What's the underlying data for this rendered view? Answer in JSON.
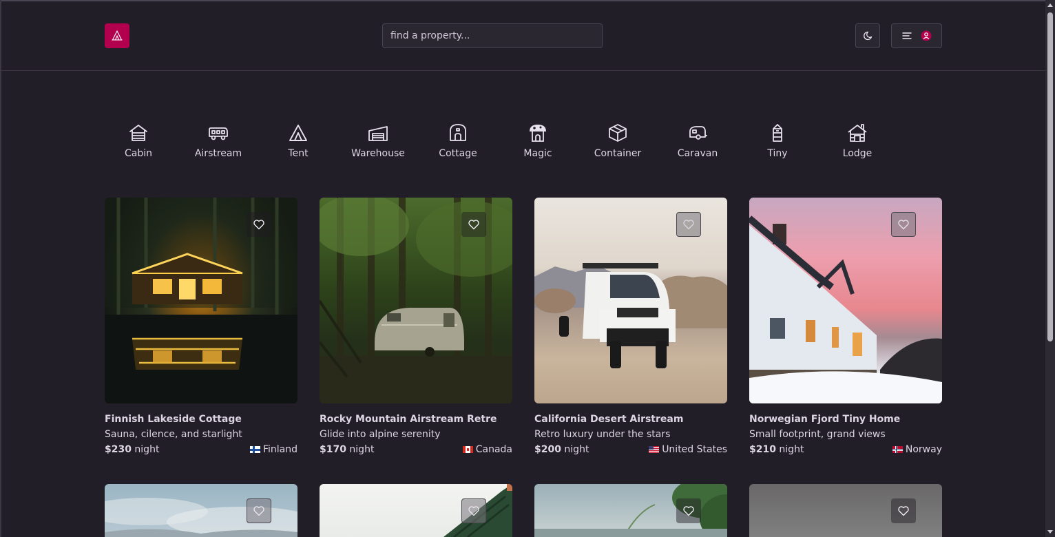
{
  "header": {
    "search_placeholder": "find a property..."
  },
  "categories": [
    {
      "label": "Cabin",
      "icon": "cabin-icon"
    },
    {
      "label": "Airstream",
      "icon": "airstream-icon"
    },
    {
      "label": "Tent",
      "icon": "tent-icon"
    },
    {
      "label": "Warehouse",
      "icon": "warehouse-icon"
    },
    {
      "label": "Cottage",
      "icon": "cottage-icon"
    },
    {
      "label": "Magic",
      "icon": "magic-icon"
    },
    {
      "label": "Container",
      "icon": "container-icon"
    },
    {
      "label": "Caravan",
      "icon": "caravan-icon"
    },
    {
      "label": "Tiny",
      "icon": "tiny-icon"
    },
    {
      "label": "Lodge",
      "icon": "lodge-icon"
    }
  ],
  "listings": [
    {
      "title": "Finnish Lakeside Cottage",
      "tagline": "Sauna, cilence, and starlight",
      "price": "$230",
      "unit": "night",
      "country": "Finland",
      "flag": "finland-flag"
    },
    {
      "title": "Rocky Mountain Airstream Retre",
      "tagline": "Glide into alpine serenity",
      "price": "$170",
      "unit": "night",
      "country": "Canada",
      "flag": "canada-flag"
    },
    {
      "title": "California Desert Airstream",
      "tagline": "Retro luxury under the stars",
      "price": "$200",
      "unit": "night",
      "country": "United States",
      "flag": "us-flag"
    },
    {
      "title": "Norwegian Fjord Tiny Home",
      "tagline": "Small footprint, grand views",
      "price": "$210",
      "unit": "night",
      "country": "Norway",
      "flag": "norway-flag"
    }
  ],
  "colors": {
    "background": "#221e28",
    "brand": "#b3004e",
    "surface": "#2b2731",
    "border": "#4a4552",
    "text": "#ddd6e3"
  }
}
